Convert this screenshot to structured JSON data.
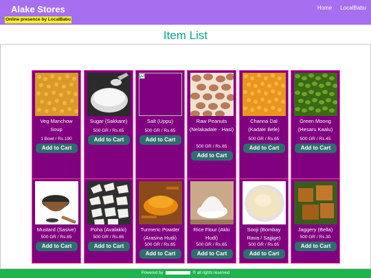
{
  "header": {
    "brand": "Alake Stores",
    "tagline": "Online presence by LocalBabu",
    "nav": [
      "Home",
      "LocalBabu"
    ]
  },
  "page_title": "Item List",
  "items": [
    {
      "name": "Veg Manchow Soup",
      "price": "1 Bowl / Rs.190",
      "button": "Add to Cart"
    },
    {
      "name": "Sugar (Sakkare)",
      "price": "500 GR / Rs.65",
      "button": "Add to Cart"
    },
    {
      "name": "Salt (Uppu)",
      "price": "500 GR / Rs.65",
      "button": "Add to Cart"
    },
    {
      "name": "Raw Peanuts (Nelakadale - Hasi)",
      "price": "500 GR / Rs.65",
      "button": "Add to Cart"
    },
    {
      "name": "Channa Dal (Kadale Bele)",
      "price": "500 GR / Rs.65",
      "button": "Add to Cart"
    },
    {
      "name": "Green Moong (Hesaru Kaalu)",
      "price": "500 GR / Rs.45",
      "button": "Add to Cart"
    },
    {
      "name": "Mustard (Sasive)",
      "price": "500 GR / Rs.65",
      "button": "Add to Cart"
    },
    {
      "name": "Poha (Avalakki)",
      "price": "500 GR / Rs.65",
      "button": "Add to Cart"
    },
    {
      "name": "Turmeric Powder (Arasina Hudi)",
      "price": "500 GR / Rs.65",
      "button": "Add to Cart"
    },
    {
      "name": "Rice Flour (Akki Hudi)",
      "price": "500 GR / Rs.65",
      "button": "Add to Cart"
    },
    {
      "name": "Sooji (Bombay Rava / Sajjige)",
      "price": "500 GR / Rs.65",
      "button": "Add to Cart"
    },
    {
      "name": "Jaggery (Bella)",
      "price": "500 GR / Rs.30",
      "button": "Add to Cart"
    }
  ],
  "footer": {
    "prefix": "Powered by",
    "suffix": "© all rights reserved"
  },
  "colors": {
    "header": "#a66ff0",
    "card": "#800080",
    "card_border": "#ff3fa6",
    "button": "#2e6e6e",
    "title": "#0aa38e",
    "footer": "#1db34d"
  }
}
